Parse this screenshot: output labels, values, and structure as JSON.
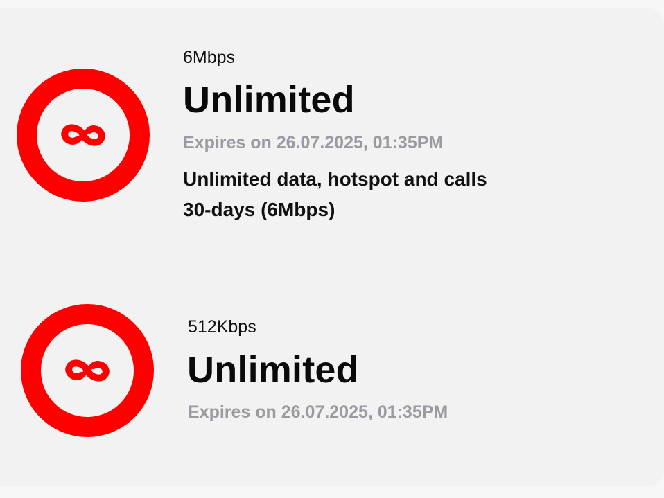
{
  "plans": [
    {
      "speed": "6Mbps",
      "name": "Unlimited",
      "expiry": "Expires on 26.07.2025, 01:35PM",
      "description_line1": "Unlimited data, hotspot and calls",
      "description_line2": "30-days (6Mbps)",
      "icon": "infinity-icon"
    },
    {
      "speed": "512Kbps",
      "name": "Unlimited",
      "expiry": "Expires on 26.07.2025, 01:35PM",
      "icon": "infinity-icon"
    }
  ],
  "colors": {
    "accent": "#ff0000",
    "card_background": "#f2f2f2",
    "muted_text": "#9a9aa2"
  }
}
